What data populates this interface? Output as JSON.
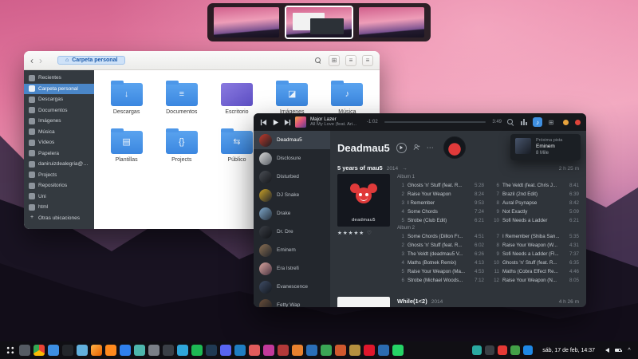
{
  "icons": {
    "back": "‹",
    "forward": "›",
    "home": "⌂",
    "grid": "⊞",
    "list": "≡",
    "menu": "≡",
    "note": "♪",
    "dots": "⋯",
    "arrow_right": "→",
    "stars": "★★★★★",
    "heart": "♡",
    "caret": "^",
    "plus": "+"
  },
  "colors": {
    "accent_blue": "#3f8fe0",
    "sidebar_active": "#4a86c8",
    "close_red": "#e0443a",
    "minimize_orange": "#e8a33d"
  },
  "files_window": {
    "path_button": "Carpeta personal",
    "sidebar": [
      {
        "label": "Recientes",
        "glyph": ""
      },
      {
        "label": "Carpeta personal",
        "glyph": "",
        "active": true
      },
      {
        "label": "Descargas",
        "glyph": ""
      },
      {
        "label": "Documentos",
        "glyph": ""
      },
      {
        "label": "Imágenes",
        "glyph": ""
      },
      {
        "label": "Música",
        "glyph": ""
      },
      {
        "label": "Vídeos",
        "glyph": ""
      },
      {
        "label": "Papelera",
        "glyph": ""
      },
      {
        "label": "daniruizdealegria@gm...",
        "glyph": ""
      },
      {
        "label": "Projects",
        "glyph": ""
      },
      {
        "label": "Repositorios",
        "glyph": ""
      },
      {
        "label": "Uni",
        "glyph": ""
      },
      {
        "label": "html",
        "glyph": ""
      },
      {
        "label": "Otras ubicaciones",
        "glyph": "+"
      }
    ],
    "folders": [
      {
        "name": "Descargas",
        "glyph": "↓",
        "bg": "linear-gradient(#5aa3ef,#3b87e0)",
        "tab": "#4d97e8"
      },
      {
        "name": "Documentos",
        "glyph": "≡",
        "bg": "linear-gradient(#5aa3ef,#3b87e0)",
        "tab": "#4d97e8"
      },
      {
        "name": "Escritorio",
        "glyph": "",
        "bg": "linear-gradient(145deg,#8a7ae0,#5d4fc4)",
        "tab": "transparent"
      },
      {
        "name": "Imágenes",
        "glyph": "◪",
        "bg": "linear-gradient(#5aa3ef,#3b87e0)",
        "tab": "#4d97e8"
      },
      {
        "name": "Música",
        "glyph": "♪",
        "bg": "linear-gradient(#5aa3ef,#3b87e0)",
        "tab": "#4d97e8"
      },
      {
        "name": "Plantillas",
        "glyph": "▤",
        "bg": "linear-gradient(#5aa3ef,#3b87e0)",
        "tab": "#4d97e8"
      },
      {
        "name": "Projects",
        "glyph": "{}",
        "bg": "linear-gradient(#5aa3ef,#3b87e0)",
        "tab": "#4d97e8"
      },
      {
        "name": "Público",
        "glyph": "⇆",
        "bg": "linear-gradient(#5aa3ef,#3b87e0)",
        "tab": "#4d97e8"
      }
    ]
  },
  "music_window": {
    "now_playing": {
      "title": "Major Lazer",
      "subtitle": "All My Love (feat. Ari...",
      "remaining": "-1:02",
      "duration": "3:49"
    },
    "next_popup": {
      "label": "Próxima pista",
      "artist": "Eminem",
      "track": "8 Mile"
    },
    "artists": [
      {
        "name": "Deadmau5",
        "avatar": "linear-gradient(135deg,#c0392b,#1c1f24)",
        "active": true
      },
      {
        "name": "Disclosure",
        "avatar": "linear-gradient(135deg,#d8d8d8,#5a5f66)"
      },
      {
        "name": "Disturbed",
        "avatar": "linear-gradient(135deg,#4a4e55,#15171b)"
      },
      {
        "name": "DJ Snake",
        "avatar": "linear-gradient(135deg,#c9a227,#22242a)"
      },
      {
        "name": "Drake",
        "avatar": "linear-gradient(135deg,#7da6c9,#27313c)"
      },
      {
        "name": "Dr. Dre",
        "avatar": "linear-gradient(135deg,#3b3f46,#101216)"
      },
      {
        "name": "Eminem",
        "avatar": "linear-gradient(135deg,#8a6f52,#23262b)"
      },
      {
        "name": "Era Istrefi",
        "avatar": "linear-gradient(135deg,#d9a6a0,#4a3340)"
      },
      {
        "name": "Evanescence",
        "avatar": "linear-gradient(135deg,#3f4d66,#14181f)"
      },
      {
        "name": "Fetty Wap",
        "avatar": "linear-gradient(135deg,#6b4f3a,#1b1e23)"
      }
    ],
    "header_artist": "Deadmau5",
    "album1": {
      "title": "5 years of mau5",
      "year": "2014",
      "duration": "2 h 25 m",
      "art_word": "deadmau5",
      "disc1_label": "Album 1",
      "disc2_label": "Album 2",
      "disc1_col1": [
        {
          "n": "1",
          "t": "Ghosts 'n' Stuff (feat. R...",
          "d": "5:28"
        },
        {
          "n": "2",
          "t": "Raise Your Weapon",
          "d": "8:24"
        },
        {
          "n": "3",
          "t": "I Remember",
          "d": "9:53"
        },
        {
          "n": "4",
          "t": "Some Chords",
          "d": "7:24"
        },
        {
          "n": "5",
          "t": "Strobe (Club Edit)",
          "d": "6:21"
        }
      ],
      "disc1_col2": [
        {
          "n": "6",
          "t": "The Veldt (feat. Chris J...",
          "d": "8:41"
        },
        {
          "n": "7",
          "t": "Brazil (2nd Edit)",
          "d": "6:39"
        },
        {
          "n": "8",
          "t": "Aural Psynapse",
          "d": "8:42"
        },
        {
          "n": "9",
          "t": "Not Exactly",
          "d": "5:09"
        },
        {
          "n": "10",
          "t": "Sofi Needs a Ladder",
          "d": "6:21"
        }
      ],
      "disc2_col1": [
        {
          "n": "1",
          "t": "Some Chords (Dillon Fr...",
          "d": "4:51"
        },
        {
          "n": "2",
          "t": "Ghosts 'n' Stuff (feat. R...",
          "d": "6:02"
        },
        {
          "n": "3",
          "t": "The Veldt (deadmau5 V...",
          "d": "6:26"
        },
        {
          "n": "4",
          "t": "Maths (Botnek Remix)",
          "d": "4:13"
        },
        {
          "n": "5",
          "t": "Raise Your Weapon (Ma...",
          "d": "4:53"
        },
        {
          "n": "6",
          "t": "Strobe (Michael Woods...",
          "d": "7:12"
        }
      ],
      "disc2_col2": [
        {
          "n": "7",
          "t": "I Remember (Shiba San...",
          "d": "5:35"
        },
        {
          "n": "8",
          "t": "Raise Your Weapon (W...",
          "d": "4:31"
        },
        {
          "n": "9",
          "t": "Sofi Needs a Ladder (Fl...",
          "d": "7:37"
        },
        {
          "n": "10",
          "t": "Ghosts 'n' Stuff (feat. R...",
          "d": "6:35"
        },
        {
          "n": "11",
          "t": "Maths (Cobra Effect Re...",
          "d": "4:46"
        },
        {
          "n": "12",
          "t": "Raise Your Weapon (N...",
          "d": "8:05"
        }
      ]
    },
    "next_album": {
      "title": "While(1<2)",
      "year": "2014",
      "duration": "4 h 26 m"
    }
  },
  "dock": {
    "items": [
      {
        "name": "app-launcher",
        "bg": "radial-gradient(circle at 30% 30%, #eee 1.2px, transparent 1.6px),radial-gradient(circle at 70% 30%, #eee 1.2px, transparent 1.6px),radial-gradient(circle at 30% 70%, #eee 1.2px, transparent 1.6px),radial-gradient(circle at 70% 70%, #eee 1.2px, transparent 1.6px)"
      },
      {
        "name": "multitasking",
        "bg": "#555b63"
      },
      {
        "name": "chrome",
        "bg": "conic-gradient(#ea4335 0 120deg,#fbbc05 0 240deg,#34a853 0 360deg)"
      },
      {
        "name": "files",
        "bg": "#3d8fe3"
      },
      {
        "name": "terminal",
        "bg": "#23262b"
      },
      {
        "name": "mail",
        "bg": "#62b0dd"
      },
      {
        "name": "firefox",
        "bg": "linear-gradient(135deg,#ffb347,#e66000)"
      },
      {
        "name": "vlc",
        "bg": "#ff8a1e"
      },
      {
        "name": "vscode",
        "bg": "#2f80ed"
      },
      {
        "name": "atom",
        "bg": "#4db6ac"
      },
      {
        "name": "gimp",
        "bg": "#7a7f87"
      },
      {
        "name": "inkscape",
        "bg": "#3a3f46"
      },
      {
        "name": "telegram",
        "bg": "#2fa6da"
      },
      {
        "name": "spotify",
        "bg": "#1db954"
      },
      {
        "name": "steam",
        "bg": "#203a53"
      },
      {
        "name": "discord",
        "bg": "#5865f2"
      },
      {
        "name": "thunderbird",
        "bg": "#1f7ec2"
      },
      {
        "name": "calendar",
        "bg": "#e05c5c"
      },
      {
        "name": "photos",
        "bg": "#c2399b"
      },
      {
        "name": "videos",
        "bg": "#b33939"
      },
      {
        "name": "music",
        "bg": "#e8812e"
      },
      {
        "name": "writer",
        "bg": "#2a6fb8"
      },
      {
        "name": "calc",
        "bg": "#3aa655"
      },
      {
        "name": "impress",
        "bg": "#d0592e"
      },
      {
        "name": "archive",
        "bg": "#b5913f"
      },
      {
        "name": "kdenlive",
        "bg": "#e0172c"
      },
      {
        "name": "virtualbox",
        "bg": "#2b6cb0"
      },
      {
        "name": "whatsapp",
        "bg": "#25d366"
      }
    ],
    "tray_icons": [
      {
        "name": "pamac-updater",
        "bg": "#2aa9a0"
      },
      {
        "name": "keyboard-layout",
        "bg": "#3a3f44"
      },
      {
        "name": "redshift",
        "bg": "#e53935"
      },
      {
        "name": "syncthing",
        "bg": "#43a047"
      },
      {
        "name": "bluetooth",
        "bg": "#1e88e5"
      }
    ],
    "date": "sáb, 17 de feb, 14:37"
  }
}
